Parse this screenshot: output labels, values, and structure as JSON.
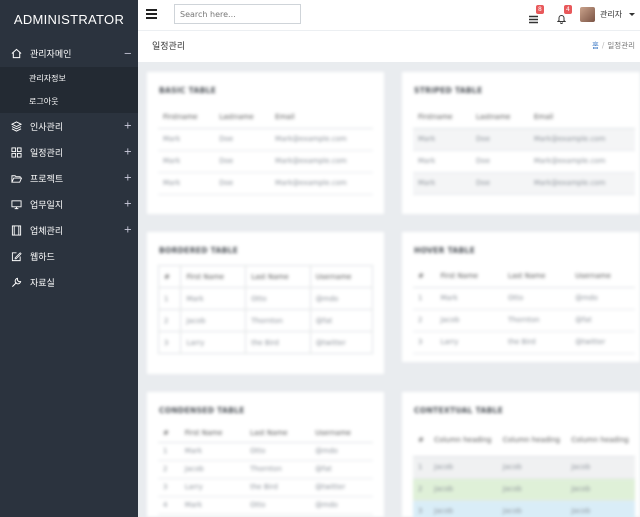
{
  "sidebar": {
    "brand": "ADMINISTRATOR",
    "items": [
      {
        "label": "관리자메인",
        "sign": "−"
      },
      {
        "label": "인사관리",
        "sign": "+"
      },
      {
        "label": "일정관리",
        "sign": "+"
      },
      {
        "label": "프로젝트",
        "sign": "+"
      },
      {
        "label": "업무일지",
        "sign": "+"
      },
      {
        "label": "업체관리",
        "sign": "+"
      },
      {
        "label": "웹하드",
        "sign": ""
      },
      {
        "label": "자료실",
        "sign": ""
      }
    ],
    "subitems": [
      "관리자정보",
      "로그아웃"
    ]
  },
  "topbar": {
    "search_placeholder": "Search here...",
    "tasks_count": "8",
    "alerts_count": "4",
    "user_name": "관리자"
  },
  "header": {
    "title": "일정관리",
    "breadcrumb_home": "홈",
    "breadcrumb_current": "일정관리"
  },
  "panels": {
    "basic": {
      "title": "BASIC TABLE",
      "headers": [
        "Firstname",
        "Lastname",
        "Email"
      ],
      "rows": [
        [
          "Mark",
          "Doe",
          "Mark@example.com"
        ],
        [
          "Mark",
          "Doe",
          "Mark@example.com"
        ],
        [
          "Mark",
          "Doe",
          "Mark@example.com"
        ]
      ]
    },
    "striped": {
      "title": "STRIPED TABLE",
      "headers": [
        "Firstname",
        "Lastname",
        "Email"
      ],
      "rows": [
        [
          "Mark",
          "Doe",
          "Mark@example.com"
        ],
        [
          "Mark",
          "Doe",
          "Mark@example.com"
        ],
        [
          "Mark",
          "Doe",
          "Mark@example.com"
        ]
      ]
    },
    "bordered": {
      "title": "BORDERED TABLE",
      "headers": [
        "#",
        "First Name",
        "Last Name",
        "Username"
      ],
      "rows": [
        [
          "1",
          "Mark",
          "Otto",
          "@mdo"
        ],
        [
          "2",
          "Jacob",
          "Thornton",
          "@fat"
        ],
        [
          "3",
          "Larry",
          "the Bird",
          "@twitter"
        ]
      ]
    },
    "hover": {
      "title": "HOVER TABLE",
      "headers": [
        "#",
        "First Name",
        "Last Name",
        "Username"
      ],
      "rows": [
        [
          "1",
          "Mark",
          "Otto",
          "@mdo"
        ],
        [
          "2",
          "Jacob",
          "Thornton",
          "@fat"
        ],
        [
          "3",
          "Larry",
          "the Bird",
          "@twitter"
        ]
      ]
    },
    "condensed": {
      "title": "CONDENSED TABLE",
      "headers": [
        "#",
        "First Name",
        "Last Name",
        "Username"
      ],
      "rows": [
        [
          "1",
          "Mark",
          "Otto",
          "@mdo"
        ],
        [
          "2",
          "Jacob",
          "Thornton",
          "@fat"
        ],
        [
          "3",
          "Larry",
          "the Bird",
          "@twitter"
        ],
        [
          "4",
          "Mark",
          "Otto",
          "@mdo"
        ]
      ]
    },
    "contextual": {
      "title": "CONTEXTUAL TABLE",
      "headers": [
        "#",
        "Column heading",
        "Column heading",
        "Column heading"
      ],
      "rows": [
        [
          "1",
          "Jacob",
          "Jacob",
          "Jacob"
        ],
        [
          "2",
          "Jacob",
          "Jacob",
          "Jacob"
        ],
        [
          "3",
          "Jacob",
          "Jacob",
          "Jacob"
        ]
      ]
    }
  },
  "colors": {
    "sidebar_bg": "#2b333e",
    "submenu_bg": "#232a33",
    "badge": "#e8585a",
    "link": "#3b78c4"
  }
}
